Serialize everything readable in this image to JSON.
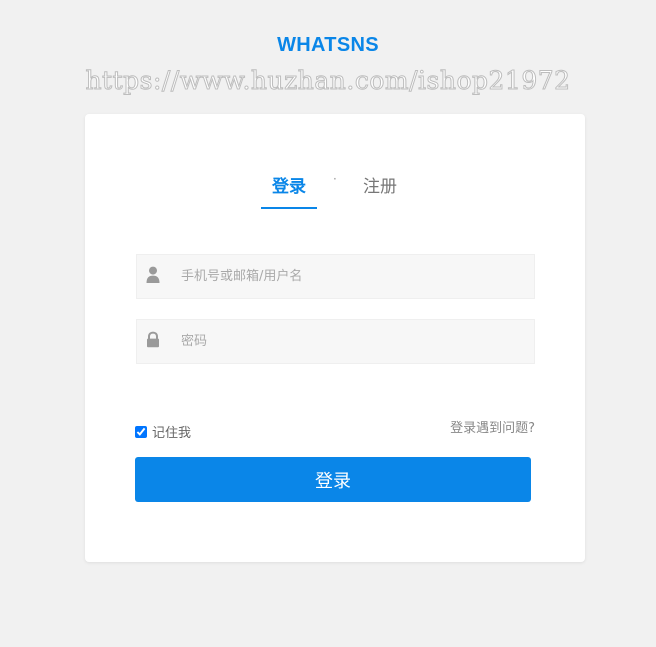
{
  "brand": {
    "name": "WHATSNS"
  },
  "watermark": {
    "text": "https://www.huzhan.com/ishop21972"
  },
  "tabs": {
    "login_label": "登录",
    "separator": "·",
    "register_label": "注册"
  },
  "form": {
    "username": {
      "placeholder": "手机号或邮箱/用户名",
      "value": "",
      "icon": "user-icon"
    },
    "password": {
      "placeholder": "密码",
      "value": "",
      "icon": "lock-icon"
    },
    "remember_label": "记住我",
    "remember_checked": true,
    "trouble_link": "登录遇到问题?",
    "submit_label": "登录"
  },
  "colors": {
    "accent": "#0a86e8",
    "background": "#f1f1f1",
    "input_bg": "#f7f7f7",
    "icon": "#9a9a9a"
  }
}
